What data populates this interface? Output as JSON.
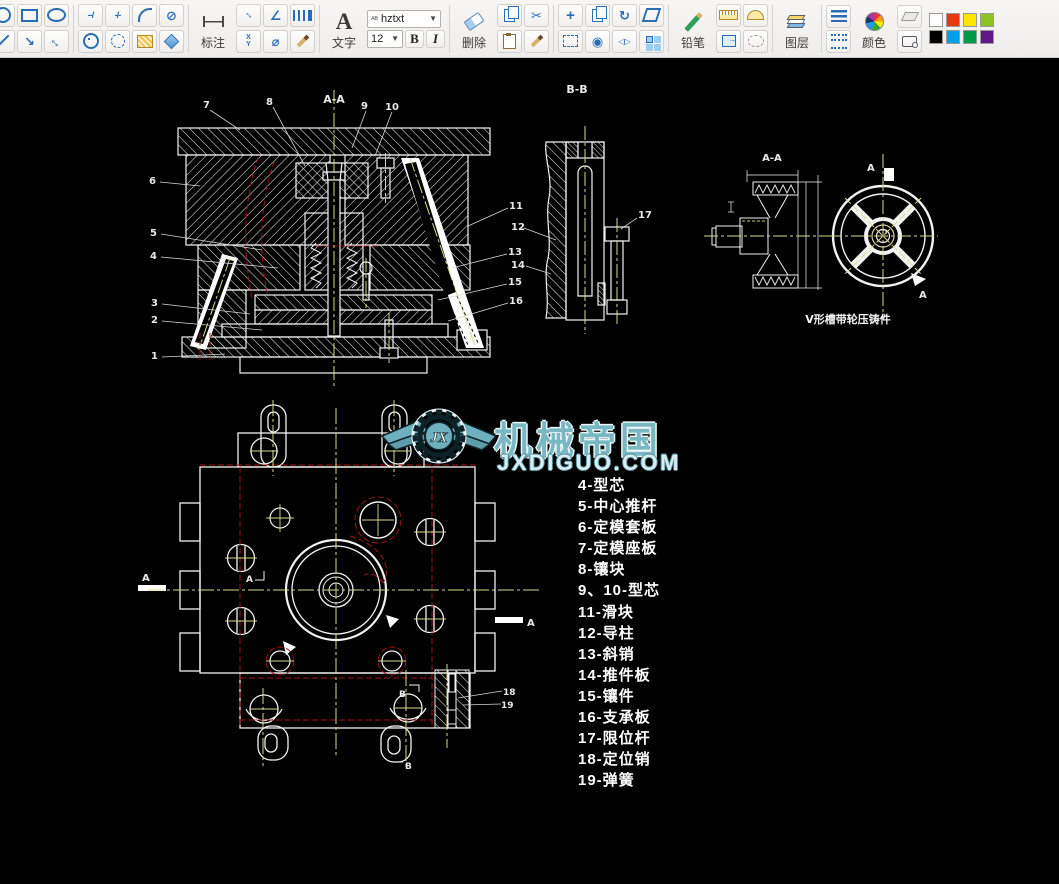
{
  "toolbar": {
    "dimension_label": "标注",
    "text_label": "文字",
    "font_name": "hztxt",
    "font_size": "12",
    "bold": "B",
    "italic": "I",
    "delete_label": "删除",
    "pencil_label": "铅笔",
    "layers_label": "图层",
    "color_label": "颜色",
    "palette": [
      "#ffffff",
      "#e8380d",
      "#ffe600",
      "#8fc31f",
      "#000000",
      "#00a0e9",
      "#009944",
      "#601986"
    ]
  },
  "drawing": {
    "colors": {
      "line": "#f2f2f2",
      "centerline": "#d9d98a",
      "hidden": "#a01414"
    },
    "section_aa": {
      "title": "A-A",
      "callouts_top": [
        "7",
        "8",
        "9",
        "10"
      ],
      "callouts_left": [
        "6",
        "5",
        "4",
        "3",
        "2",
        "1"
      ],
      "callouts_right": [
        "11",
        "12",
        "13",
        "14",
        "15",
        "16"
      ]
    },
    "section_bb": {
      "title": "B-B",
      "callout": "17"
    },
    "pulley": {
      "section_title": "A-A",
      "caption": "V形槽带轮压铸件",
      "arrow_top": "A",
      "arrow_bottom": "A"
    },
    "plan": {
      "arrow_left": "A",
      "arrow_right": "A",
      "arrow_inner": "A",
      "callout_18": "18",
      "callout_19": "19",
      "mark_b_top": "B",
      "mark_b_bottom": "B"
    },
    "watermark": {
      "monogram": "JX",
      "title": "机械帝国",
      "site": "JXDIGUO.COM"
    },
    "parts_list": [
      "4-型芯",
      "5-中心推杆",
      "6-定模套板",
      "7-定模座板",
      "8-镶块",
      "9、10-型芯",
      "11-滑块",
      "12-导柱",
      "13-斜销",
      "14-推件板",
      "15-镶件",
      "16-支承板",
      "17-限位杆",
      "18-定位销",
      "19-弹簧"
    ]
  }
}
